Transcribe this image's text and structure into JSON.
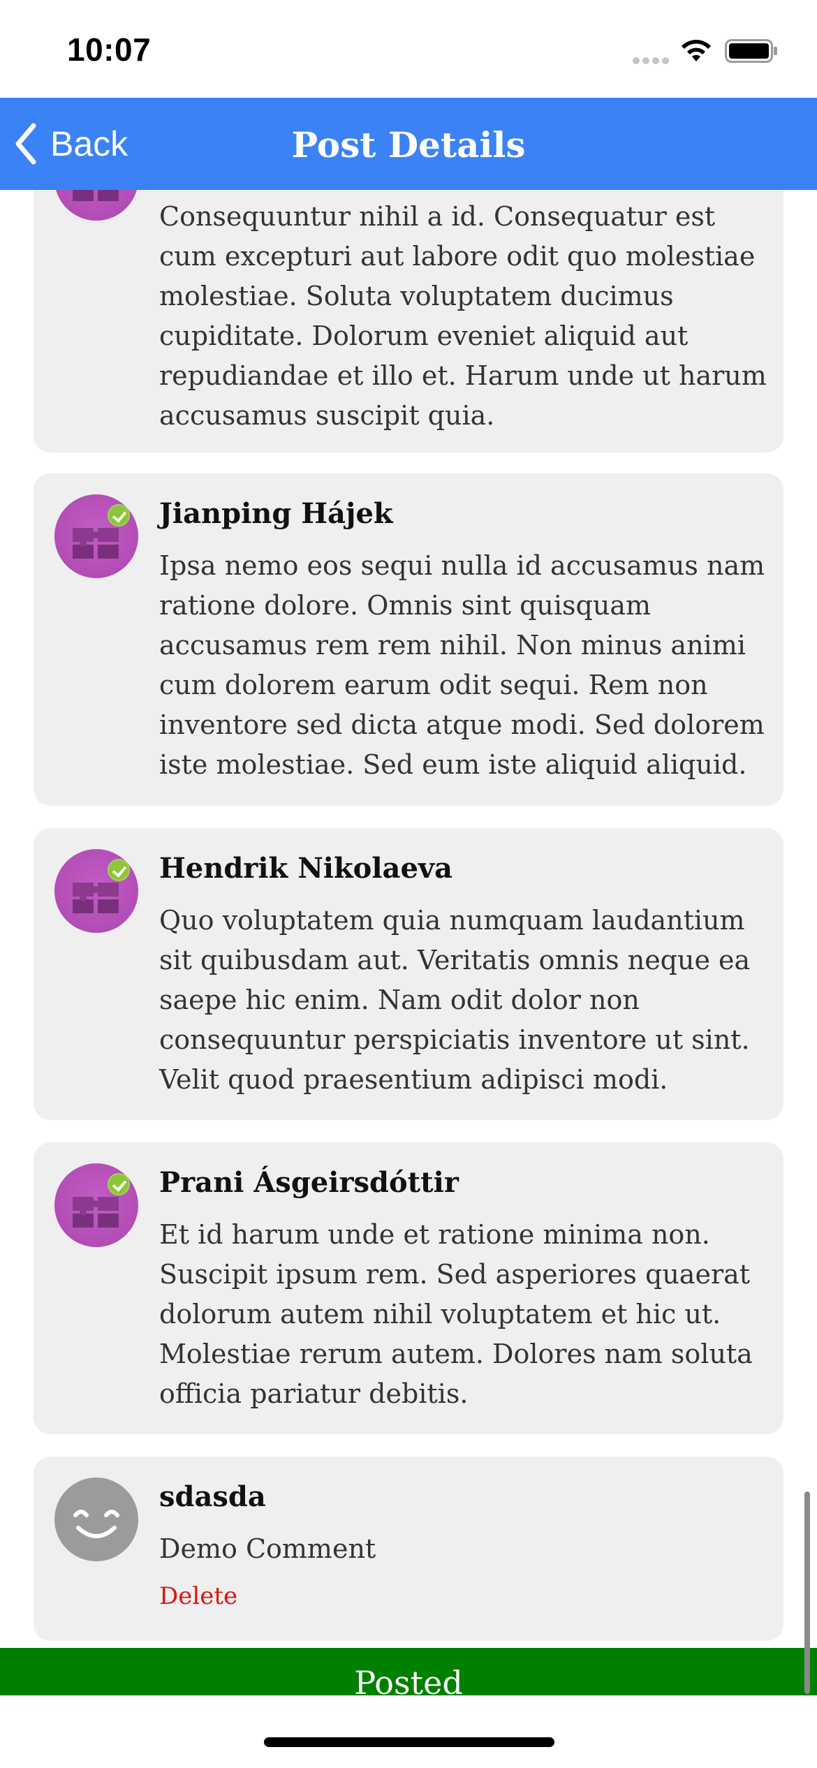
{
  "status_bar": {
    "time": "10:07"
  },
  "nav": {
    "back_label": "Back",
    "title": "Post Details"
  },
  "comments": [
    {
      "author": "",
      "body": "Consequuntur nihil a id. Consequatur est cum excepturi aut labore odit quo molestiae molestiae. Soluta voluptatem ducimus cupiditate. Dolorum eveniet aliquid aut repudiandae et illo et. Harum unde ut harum accusamus suscipit quia."
    },
    {
      "author": "Jianping Hájek",
      "body": "Ipsa nemo eos sequi nulla id accusamus nam ratione dolore. Omnis sint quisquam accusamus rem rem nihil. Non minus animi cum dolorem earum odit sequi. Rem non inventore sed dicta atque modi. Sed dolorem iste molestiae. Sed eum iste aliquid aliquid."
    },
    {
      "author": "Hendrik Nikolaeva",
      "body": "Quo voluptatem quia numquam laudantium sit quibusdam aut. Veritatis omnis neque ea saepe hic enim. Nam odit dolor non consequuntur perspiciatis inventore ut sint. Velit quod praesentium adipisci modi."
    },
    {
      "author": "Prani Ásgeirsdóttir",
      "body": "Et id harum unde et ratione minima non. Suscipit ipsum rem. Sed asperiores quaerat dolorum autem nihil voluptatem et hic ut. Molestiae rerum autem. Dolores nam soluta officia pariatur debitis."
    },
    {
      "author": "sdasda",
      "body": "Demo Comment",
      "delete_label": "Delete"
    }
  ],
  "posted_bar": {
    "label": "Posted",
    "color": "#008000"
  },
  "colors": {
    "nav_bg": "#3b82f6",
    "card_bg": "#efefef",
    "delete": "#e01010"
  },
  "icons": [
    "back-chevron-icon",
    "wifi-icon",
    "battery-icon",
    "signal-icon",
    "puzzle-avatar-icon",
    "smiley-avatar-icon"
  ]
}
